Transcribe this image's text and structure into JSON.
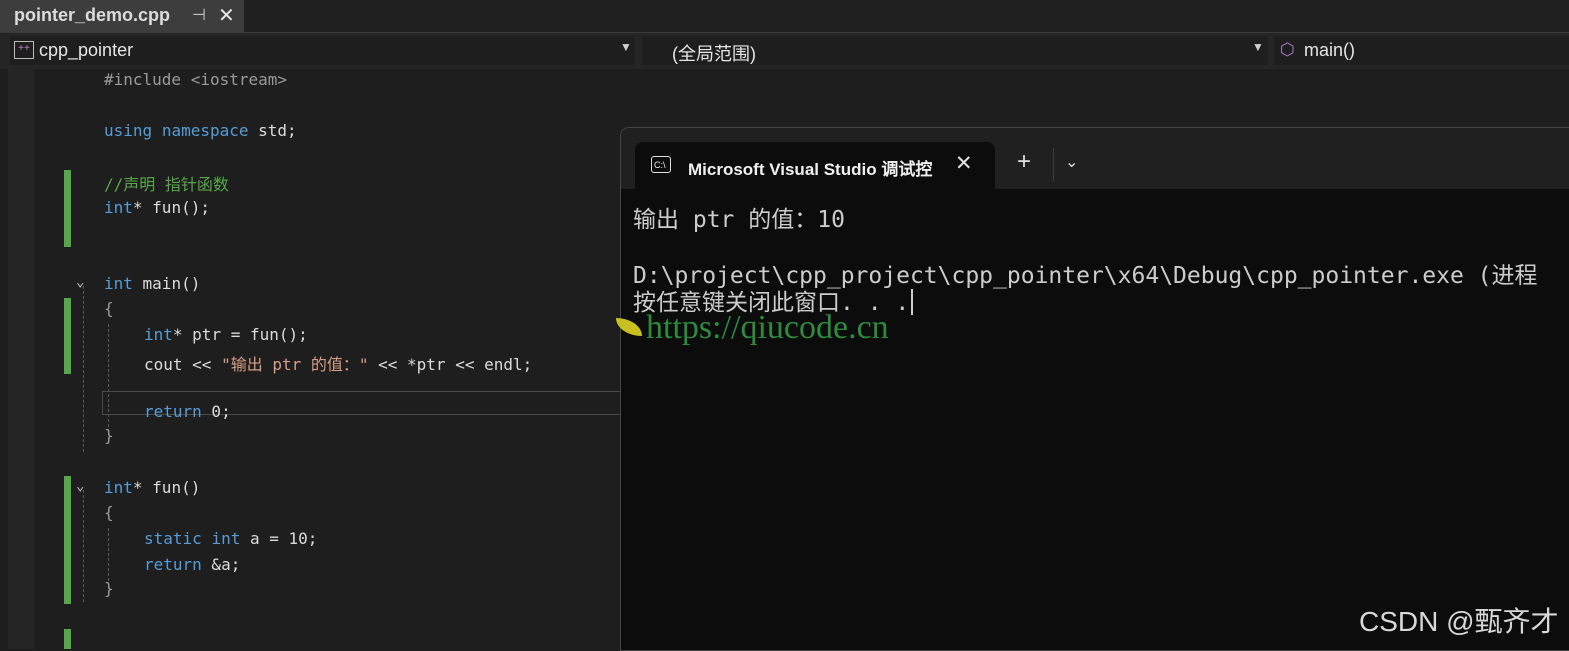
{
  "editor_tab": {
    "filename": "pointer_demo.cpp",
    "pin_icon": "pin-icon",
    "close_icon": "close-icon"
  },
  "navbar": {
    "project": "cpp_pointer",
    "scope": "(全局范围)",
    "member": "main()"
  },
  "code": {
    "include": "#include <iostream>",
    "using_kw": "using",
    "namespace_kw": "namespace",
    "std": " std;",
    "comment": "//声明 指针函数",
    "decl_type": "int",
    "decl_rest": "* fun();",
    "main_type": "int",
    "main_name": " main()",
    "open1": "{",
    "l1_type": "int",
    "l1_rest": "* ptr = fun();",
    "l2_a": "cout << ",
    "l2_str": "\"输出 ptr 的值：\"",
    "l2_b": " << *ptr << endl;",
    "ret0_kw": "return",
    "ret0_rest": " 0;",
    "close1": "}",
    "fun_type": "int",
    "fun_rest": "* fun()",
    "open2": "{",
    "s_static": "static",
    "s_int": "int",
    "s_rest": " a = 10;",
    "ret_kw": "return",
    "ret_rest": " &a;",
    "close2": "}"
  },
  "terminal": {
    "tab_title": "Microsoft Visual Studio 调试控",
    "line1": "输出 ptr 的值：10",
    "line2": "D:\\project\\cpp_project\\cpp_pointer\\x64\\Debug\\cpp_pointer.exe (进程",
    "line3": "按任意键关闭此窗口. . ."
  },
  "watermark": {
    "url": "https://qiucode.cn"
  },
  "csdn": "CSDN @甄齐才",
  "colors": {
    "keyword": "#569cd6",
    "comment": "#57a64a",
    "string": "#d69d85",
    "change_bar": "#57a64a"
  }
}
